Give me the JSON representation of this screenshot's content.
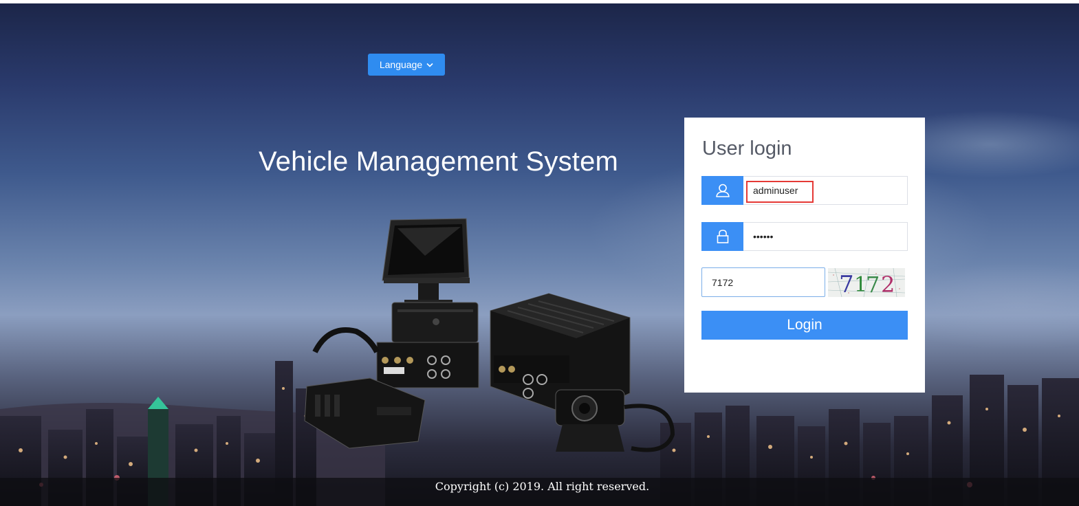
{
  "header": {
    "language_label": "Language"
  },
  "app": {
    "title": "Vehicle Management System"
  },
  "login": {
    "title": "User login",
    "username_value": "adminuser",
    "password_value": "123456",
    "captcha_value": "7172",
    "captcha_text": "7172",
    "submit_label": "Login"
  },
  "footer": {
    "copyright": "Copyright (c) 2019. All right reserved."
  },
  "colors": {
    "accent": "#3b8ff5",
    "highlight": "#e53935"
  }
}
